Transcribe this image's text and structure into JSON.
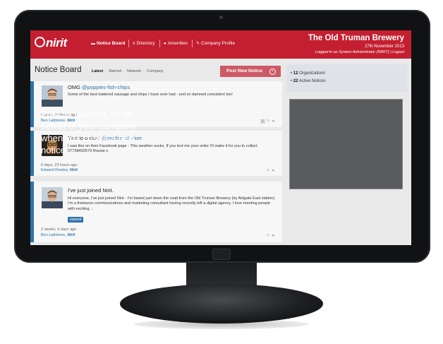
{
  "header": {
    "logo_text": "nirit",
    "nav": [
      {
        "label": "Notice Board",
        "icon": "speech-bubble-icon",
        "glyph": "▬",
        "bold": true
      },
      {
        "label": "Directory",
        "icon": "list-icon",
        "glyph": "≡"
      },
      {
        "label": "Amenities",
        "icon": "pin-icon",
        "glyph": "●"
      },
      {
        "label": "Company Profile",
        "icon": "pencil-icon",
        "glyph": "✎"
      }
    ],
    "org_name": "The Old Truman Brewery",
    "date": "27th November 2013",
    "logged_in": "Logged in as System Administrator (NIRIT)",
    "logout": "Logout"
  },
  "notice_board": {
    "title": "Notice Board",
    "tabs": [
      "Latest",
      "Starred",
      "Network",
      "Company"
    ],
    "post_button": "Post New Notice"
  },
  "notices": [
    {
      "title": "OMG",
      "handle": "@poppies-fish-chips",
      "body": "Some of the best battered sausage and chips I have ever had - and so damned consistent too!",
      "time": "6 days, 23 hours ago",
      "author": "Ben Lattimore,",
      "company": "Nirit",
      "count": "1"
    },
    {
      "title": "Text to order?",
      "handle": "@mother-clucker",
      "body": "I saw this on their Facebook page - This weather sucks. If you text me your order I'll make it for you to collect. 07738492579 Rossie x",
      "time": "6 days, 23 hours ago",
      "author": "Edward Rowley,",
      "company": "Nirit"
    },
    {
      "title": "I've just joined Nirit.",
      "body": "Hi everyone, I've just joined Nirit - I'm based just down the road from the Old Truman Brewery (by Aldgate East station). I'm a freelance communications and marketing consultant having recently left a digital agency. I love meeting people with exciting ...",
      "expand": "expand",
      "time": "2 weeks, 6 days ago",
      "author": "Ben Lattimore,",
      "company": "Nirit"
    }
  ],
  "stats": [
    {
      "value": "12",
      "label": "Organizations"
    },
    {
      "value": "22",
      "label": "Active Notices"
    }
  ],
  "promo": "Post as yourself, or on behalf of your company when you create a new notice",
  "colors": {
    "brand_red": "#c41f30",
    "accent_blue": "#2b73a8",
    "button_pink": "#cd5a66"
  }
}
